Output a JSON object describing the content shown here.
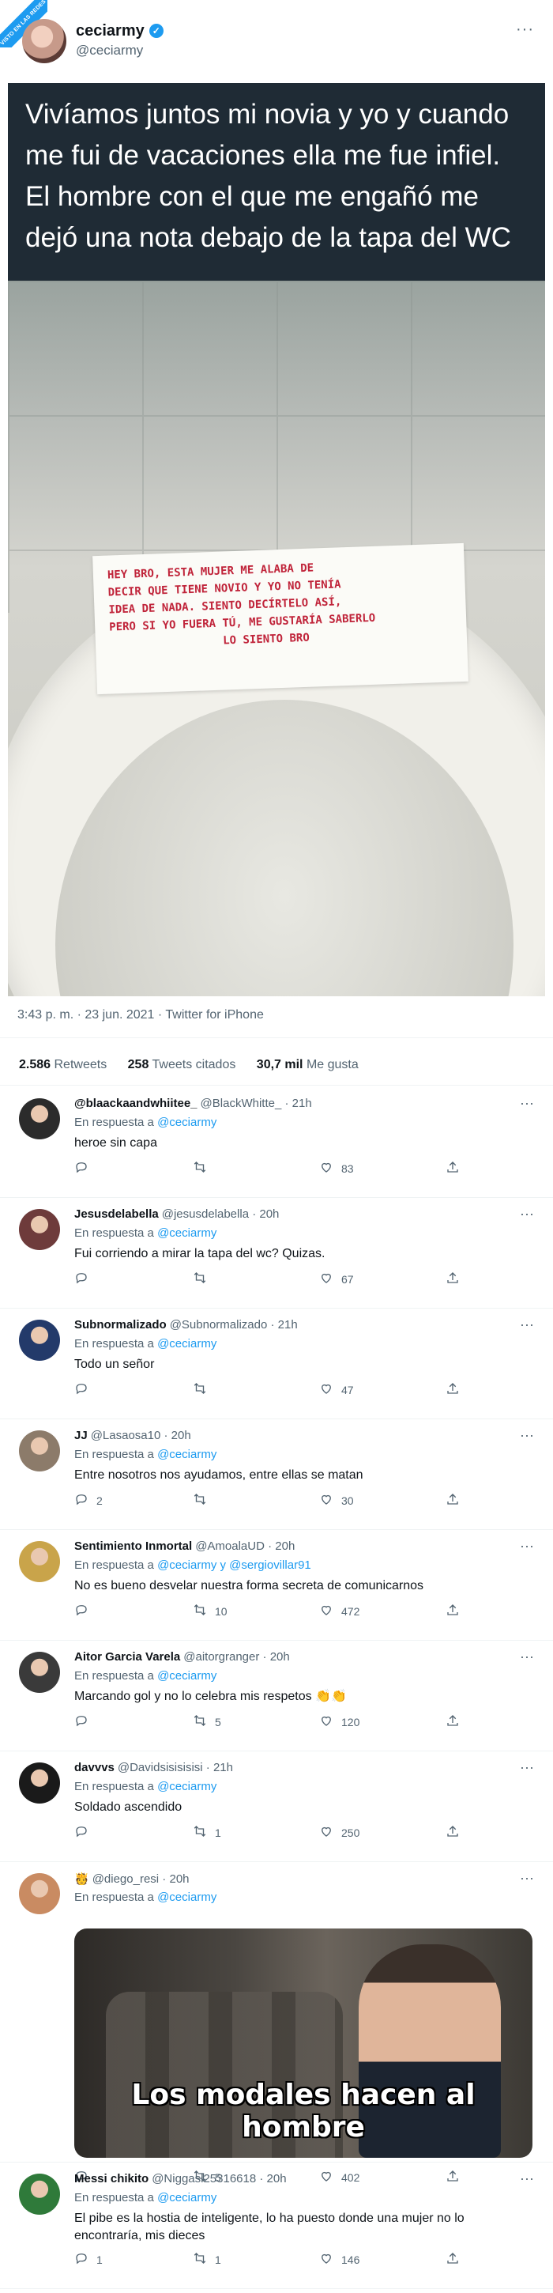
{
  "watermark": "VISTO EN LAS REDES",
  "tweet": {
    "author_name": "ceciarmy",
    "author_handle": "@ceciarmy",
    "caption": "Vivíamos juntos mi novia y yo y cuando me fui de vacaciones ella me fue infiel. El hombre con el que me engañó me dejó una nota debajo de la tapa del WC",
    "note_text": "HEY BRO, ESTA MUJER ME ALABA DE\nDECIR QUE TIENE NOVIO Y YO NO TENÍA\nIDEA DE NADA. SIENTO DECÍRTELO ASÍ,\nPERO SI YO FUERA TÚ, ME GUSTARÍA SABERLO\n                 LO SIENTO BRO",
    "timestamp": "3:43 p. m. · 23 jun. 2021 · Twitter for iPhone",
    "stats": {
      "retweets_count": "2.586",
      "retweets_label": "Retweets",
      "quotes_count": "258",
      "quotes_label": "Tweets citados",
      "likes_count": "30,7 mil",
      "likes_label": "Me gusta"
    }
  },
  "replies": [
    {
      "name": "@blaackaandwhiitee_",
      "handle": "@BlackWhitte_",
      "time": "21h",
      "resp_prefix": "En respuesta a",
      "mentions": "@ceciarmy",
      "text": "heroe sin capa",
      "replies": "",
      "retweets": "",
      "likes": "83",
      "avatar_color": "#2b2b2b"
    },
    {
      "name": "Jesusdelabella",
      "handle": "@jesusdelabella",
      "time": "20h",
      "resp_prefix": "En respuesta a",
      "mentions": "@ceciarmy",
      "text": "Fui corriendo a mirar la tapa del wc? Quizas.",
      "replies": "",
      "retweets": "",
      "likes": "67",
      "avatar_color": "#6e3b3b"
    },
    {
      "name": "Subnormalizado",
      "handle": "@Subnormalizado",
      "time": "21h",
      "resp_prefix": "En respuesta a",
      "mentions": "@ceciarmy",
      "text": "Todo un señor",
      "replies": "",
      "retweets": "",
      "likes": "47",
      "avatar_color": "#233a6a"
    },
    {
      "name": "JJ",
      "handle": "@Lasaosa10",
      "time": "20h",
      "resp_prefix": "En respuesta a",
      "mentions": "@ceciarmy",
      "text": "Entre nosotros nos ayudamos, entre ellas se matan",
      "replies": "2",
      "retweets": "",
      "likes": "30",
      "avatar_color": "#8c7b6a"
    },
    {
      "name": "Sentimiento Inmortal",
      "handle": "@AmoalaUD",
      "time": "20h",
      "resp_prefix": "En respuesta a",
      "mentions": "@ceciarmy y @sergiovillar91",
      "text": "No es bueno desvelar nuestra forma secreta de comunicarnos",
      "replies": "",
      "retweets": "10",
      "likes": "472",
      "avatar_color": "#c9a44a"
    },
    {
      "name": "Aitor Garcia Varela",
      "handle": "@aitorgranger",
      "time": "20h",
      "resp_prefix": "En respuesta a",
      "mentions": "@ceciarmy",
      "text": "Marcando gol y no lo celebra mis respetos 👏👏",
      "replies": "",
      "retweets": "5",
      "likes": "120",
      "avatar_color": "#3a3a3a"
    },
    {
      "name": "davvvs",
      "handle": "@Davidsisisisisi",
      "time": "21h",
      "resp_prefix": "En respuesta a",
      "mentions": "@ceciarmy",
      "text": "Soldado ascendido",
      "replies": "",
      "retweets": "1",
      "likes": "250",
      "avatar_color": "#1a1a1a"
    },
    {
      "name": "🫅",
      "handle": "@diego_resi",
      "time": "20h",
      "resp_prefix": "En respuesta a",
      "mentions": "@ceciarmy",
      "text": "",
      "gif_caption": "Los modales hacen al hombre",
      "replies": "",
      "retweets": "5",
      "likes": "402",
      "avatar_color": "#c98b62"
    },
    {
      "name": "Messi chikito",
      "handle": "@Niggasl25316618",
      "time": "20h",
      "resp_prefix": "En respuesta a",
      "mentions": "@ceciarmy",
      "text": "El pibe es la hostia de inteligente, lo ha puesto donde una mujer no lo encontraría, mis dieces",
      "replies": "1",
      "retweets": "1",
      "likes": "146",
      "avatar_color": "#2f7a3a"
    }
  ]
}
